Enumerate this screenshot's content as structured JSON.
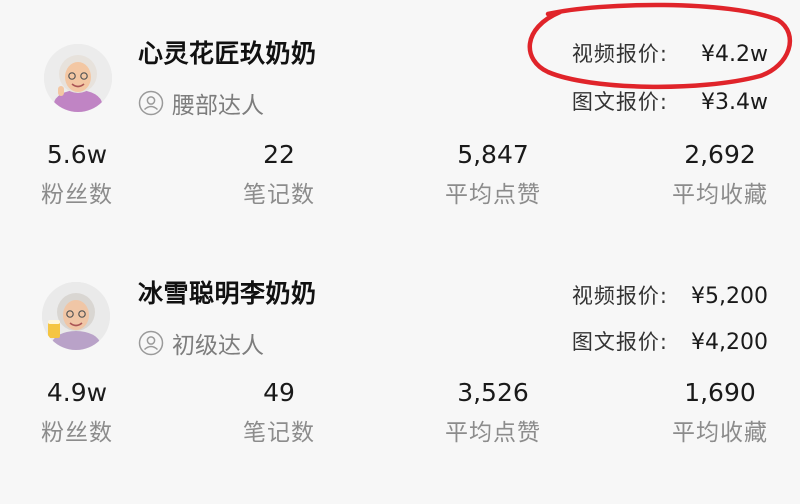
{
  "creators": [
    {
      "name": "心灵花匠玖奶奶",
      "level": "腰部达人",
      "video_price_label": "视频报价:",
      "video_price": "¥4.2w",
      "image_price_label": "图文报价:",
      "image_price": "¥3.4w",
      "stats": [
        {
          "value": "5.6w",
          "label": "粉丝数"
        },
        {
          "value": "22",
          "label": "笔记数"
        },
        {
          "value": "5,847",
          "label": "平均点赞"
        },
        {
          "value": "2,692",
          "label": "平均收藏"
        }
      ]
    },
    {
      "name": "冰雪聪明李奶奶",
      "level": "初级达人",
      "video_price_label": "视频报价:",
      "video_price": "¥5,200",
      "image_price_label": "图文报价:",
      "image_price": "¥4,200",
      "stats": [
        {
          "value": "4.9w",
          "label": "粉丝数"
        },
        {
          "value": "49",
          "label": "笔记数"
        },
        {
          "value": "3,526",
          "label": "平均点赞"
        },
        {
          "value": "1,690",
          "label": "平均收藏"
        }
      ]
    }
  ],
  "icons": {
    "avatar": "elderly-woman-avatar",
    "level": "user-circle-icon"
  },
  "colors": {
    "highlight_circle": "#e0242a",
    "label_gray": "#8c8c8c",
    "value_dark": "#1a1a1a",
    "background": "#f7f7f7"
  }
}
